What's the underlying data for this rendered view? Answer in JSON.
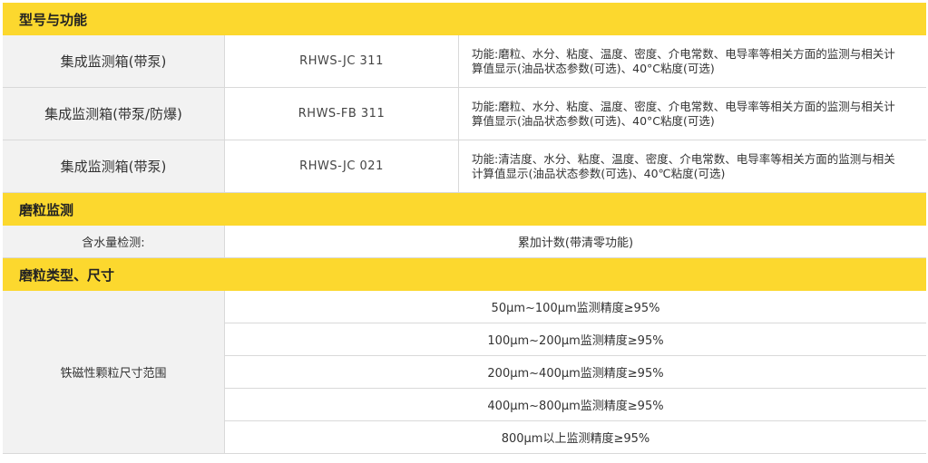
{
  "section_models": {
    "title": "型号与功能"
  },
  "products": [
    {
      "name": "集成监测箱(带泵)",
      "model": "RHWS-JC 311",
      "function": "功能:磨粒、水分、粘度、温度、密度、介电常数、电导率等相关方面的监测与相关计算值显示(油品状态参数(可选)、40°C粘度(可选)"
    },
    {
      "name": "集成监测箱(带泵/防爆)",
      "model": "RHWS-FB 311",
      "function": "功能:磨粒、水分、粘度、温度、密度、介电常数、电导率等相关方面的监测与相关计算值显示(油品状态参数(可选)、40°C粘度(可选)"
    },
    {
      "name": "集成监测箱(带泵)",
      "model": "RHWS-JC 021",
      "function": "功能:清洁度、水分、粘度、温度、密度、介电常数、电导率等相关方面的监测与相关计算值显示(油品状态参数(可选)、40℃粘度(可选)"
    }
  ],
  "section_wear": {
    "title": "磨粒监测"
  },
  "water": {
    "label": "含水量检测:",
    "value": "累加计数(带清零功能)"
  },
  "section_size": {
    "title": "磨粒类型、尺寸"
  },
  "size": {
    "label": "铁磁性颗粒尺寸范围",
    "items": [
      "50μm~100μm监测精度≥95%",
      "100μm~200μm监测精度≥95%",
      "200μm~400μm监测精度≥95%",
      "400μm~800μm监测精度≥95%",
      "800μm以上监测精度≥95%"
    ]
  }
}
